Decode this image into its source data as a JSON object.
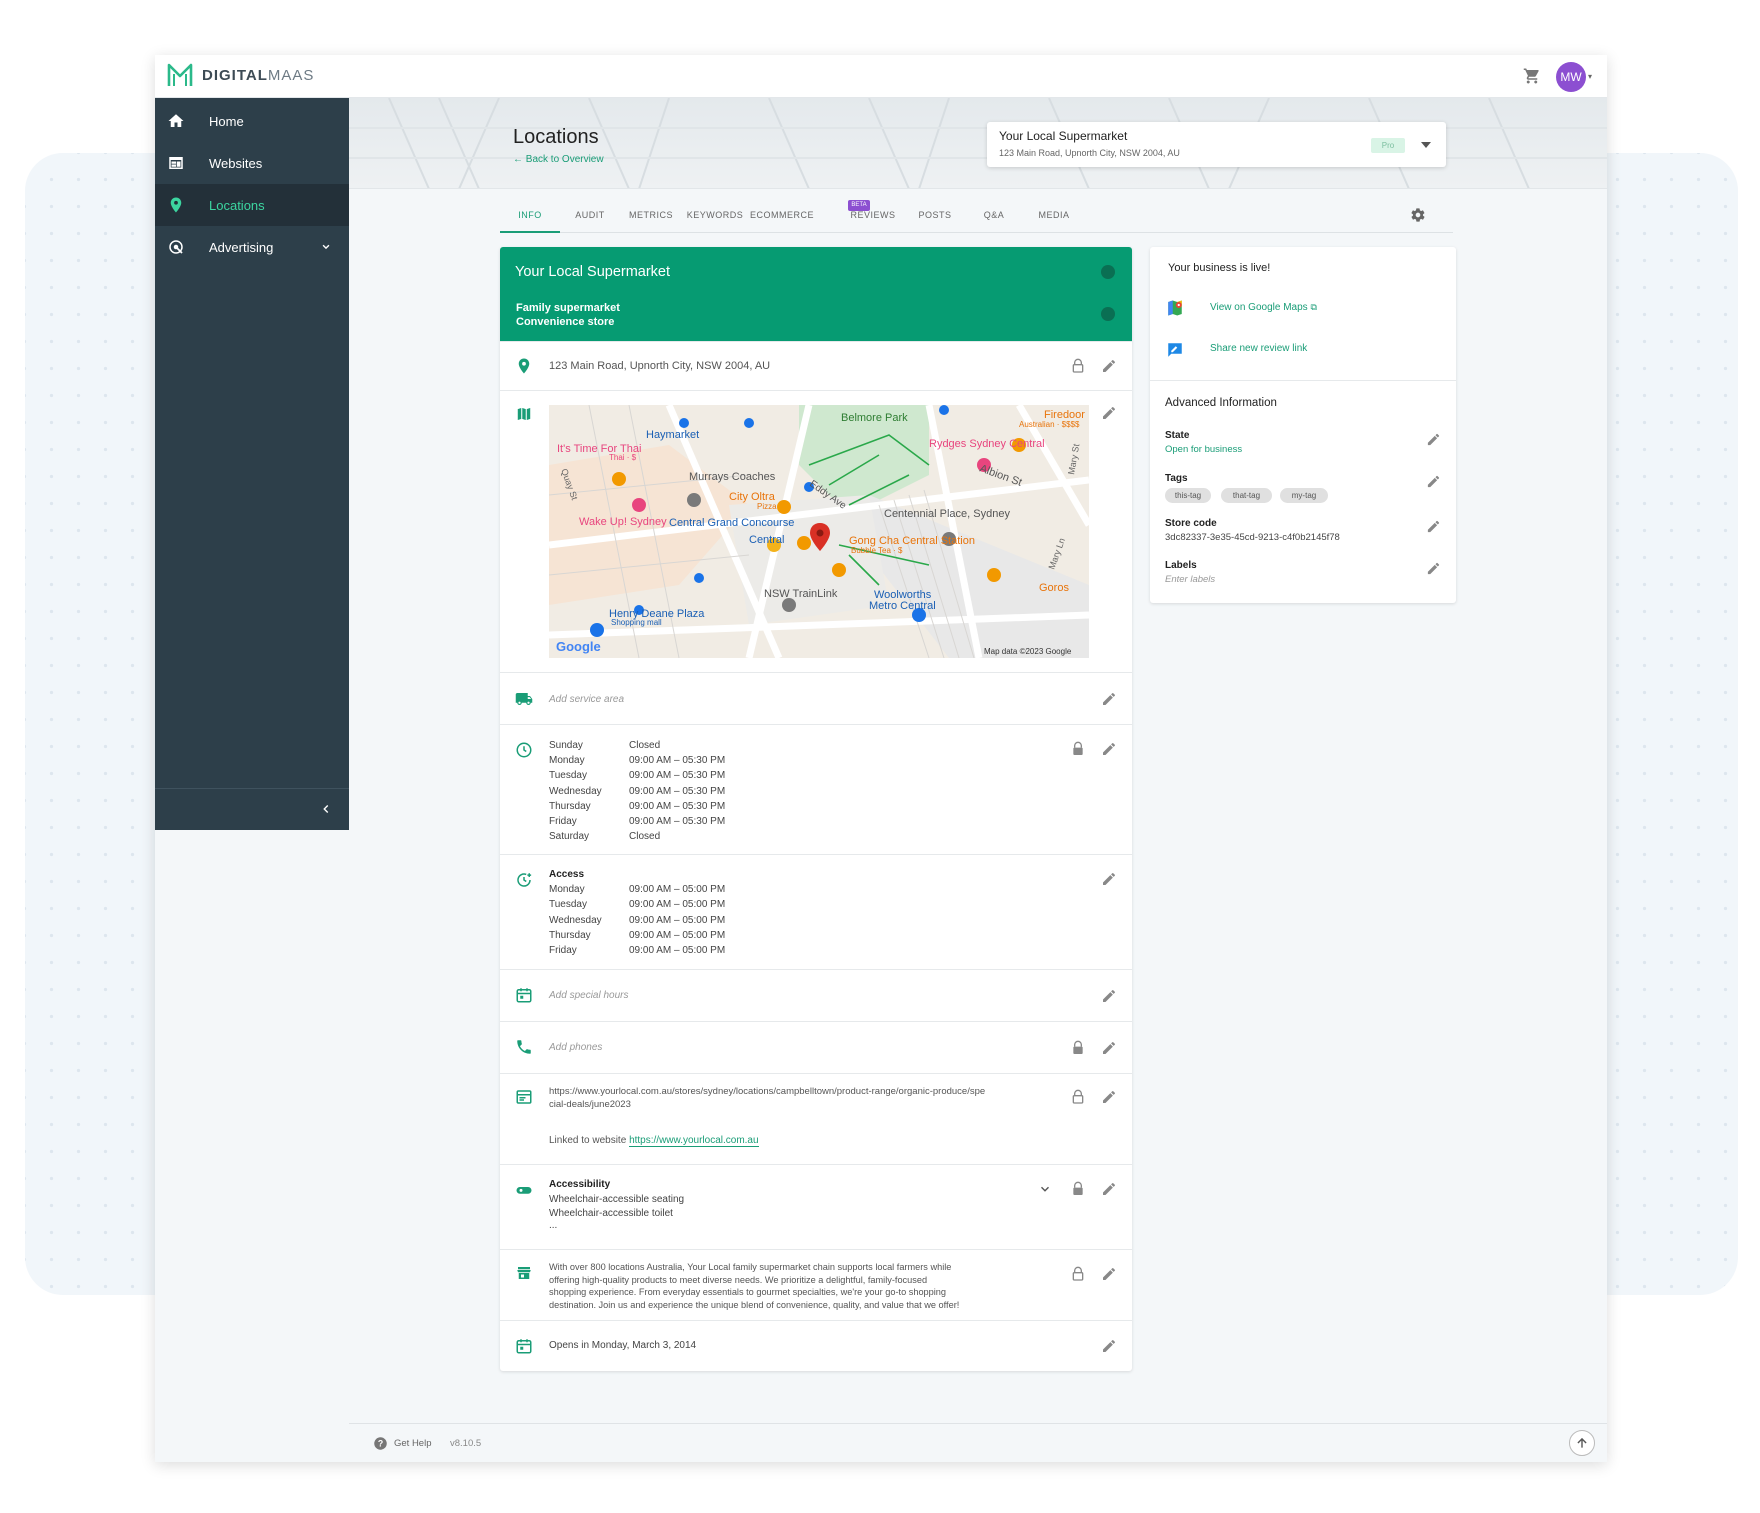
{
  "brand": {
    "logo_bold": "DIGITAL",
    "logo_light": "MAAS",
    "accent": "#1a9d77",
    "sidebar_bg": "#2d3f4a"
  },
  "topbar": {
    "avatar_initials": "MW",
    "cart_icon": "cart-icon"
  },
  "sidebar": {
    "items": [
      {
        "label": "Home",
        "icon": "home-icon"
      },
      {
        "label": "Websites",
        "icon": "websites-icon"
      },
      {
        "label": "Locations",
        "icon": "location-pin-icon"
      },
      {
        "label": "Advertising",
        "icon": "advertising-icon"
      }
    ]
  },
  "header": {
    "title": "Locations",
    "back_link": "Back to Overview"
  },
  "location_select": {
    "name": "Your Local Supermarket",
    "address": "123 Main Road, Upnorth City, NSW 2004, AU",
    "badge": "Pro"
  },
  "tabs": [
    "INFO",
    "AUDIT",
    "METRICS",
    "KEYWORDS",
    "ECOMMERCE",
    "REVIEWS",
    "POSTS",
    "Q&A",
    "MEDIA"
  ],
  "beta_label": "BETA",
  "business": {
    "name": "Your Local Supermarket",
    "category_primary": "Family supermarket",
    "category_secondary": "Convenience store",
    "address": "123 Main Road, Upnorth City, NSW 2004, AU",
    "service_area_placeholder": "Add service area",
    "hours": [
      {
        "day": "Sunday",
        "time": "Closed"
      },
      {
        "day": "Monday",
        "time": "09:00 AM – 05:30 PM"
      },
      {
        "day": "Tuesday",
        "time": "09:00 AM – 05:30 PM"
      },
      {
        "day": "Wednesday",
        "time": "09:00 AM – 05:30 PM"
      },
      {
        "day": "Thursday",
        "time": "09:00 AM – 05:30 PM"
      },
      {
        "day": "Friday",
        "time": "09:00 AM – 05:30 PM"
      },
      {
        "day": "Saturday",
        "time": "Closed"
      }
    ],
    "access_title": "Access",
    "access_hours": [
      {
        "day": "Monday",
        "time": "09:00 AM – 05:00 PM"
      },
      {
        "day": "Tuesday",
        "time": "09:00 AM – 05:00 PM"
      },
      {
        "day": "Wednesday",
        "time": "09:00 AM – 05:00 PM"
      },
      {
        "day": "Thursday",
        "time": "09:00 AM – 05:00 PM"
      },
      {
        "day": "Friday",
        "time": "09:00 AM – 05:00 PM"
      }
    ],
    "special_hours_placeholder": "Add special hours",
    "phones_placeholder": "Add phones",
    "url_line1": "https://www.yourlocal.com.au/stores/sydney/locations/campbelltown/product-range/organic-produce/spe",
    "url_line2": "cial-deals/june2023",
    "linked_prefix": "Linked to website",
    "linked_url": "https://www.yourlocal.com.au",
    "accessibility_title": "Accessibility",
    "accessibility_items": [
      "Wheelchair-accessible seating",
      "Wheelchair-accessible toilet",
      "..."
    ],
    "description_lines": [
      "With over 800 locations Australia, Your Local family supermarket chain supports local farmers while",
      "offering high-quality products to meet diverse needs. We prioritize a delightful, family-focused",
      "shopping experience. From everyday essentials to gourmet specialties, we're your go-to shopping",
      "destination. Join us and experience the unique blend of convenience, quality, and value that we offer!"
    ],
    "opening_date": "Opens in Monday, March 3, 2014"
  },
  "map": {
    "labels": {
      "belmore": "Belmore Park",
      "haymarket": "Haymarket",
      "thai": "It's Time For Thai",
      "thai_sub": "Thai · $",
      "rydges": "Rydges Sydney Central",
      "firedoor": "Firedoor",
      "firedoor_sub": "Australian · $$$$",
      "murrays": "Murrays Coaches",
      "cityoltra": "City Oltra",
      "cityoltra_sub": "Pizza",
      "eddy": "Eddy Ave",
      "albion": "Albion St",
      "quay": "Quay St",
      "mary": "Mary St",
      "wakeup": "Wake Up! Sydney",
      "concourse": "Central Grand Concourse",
      "centennial": "Centennial Place, Sydney",
      "central": "Central",
      "gongcha": "Gong Cha Central Station",
      "gongcha_sub": "Bubble Tea · $",
      "trainlink": "NSW TrainLink",
      "woolworths": "Woolworths",
      "woolworths2": "Metro Central",
      "goros": "Goros",
      "maryln": "Mary Ln",
      "henry": "Henry Deane Plaza",
      "henry_sub": "Shopping mall",
      "google": "Google",
      "mapdata": "Map data ©2023 Google"
    }
  },
  "side_panel": {
    "live_title": "Your business is live!",
    "maps_link": "View on Google Maps",
    "review_link": "Share new review link",
    "advanced_title": "Advanced Information",
    "state_label": "State",
    "state_value": "Open for business",
    "tags_label": "Tags",
    "tags": [
      "this-tag",
      "that-tag",
      "my-tag"
    ],
    "store_code_label": "Store code",
    "store_code": "3dc82337-3e35-45cd-9213-c4f0b2145f78",
    "labels_label": "Labels",
    "labels_placeholder": "Enter labels"
  },
  "footer": {
    "help": "Get Help",
    "version": "v8.10.5"
  }
}
